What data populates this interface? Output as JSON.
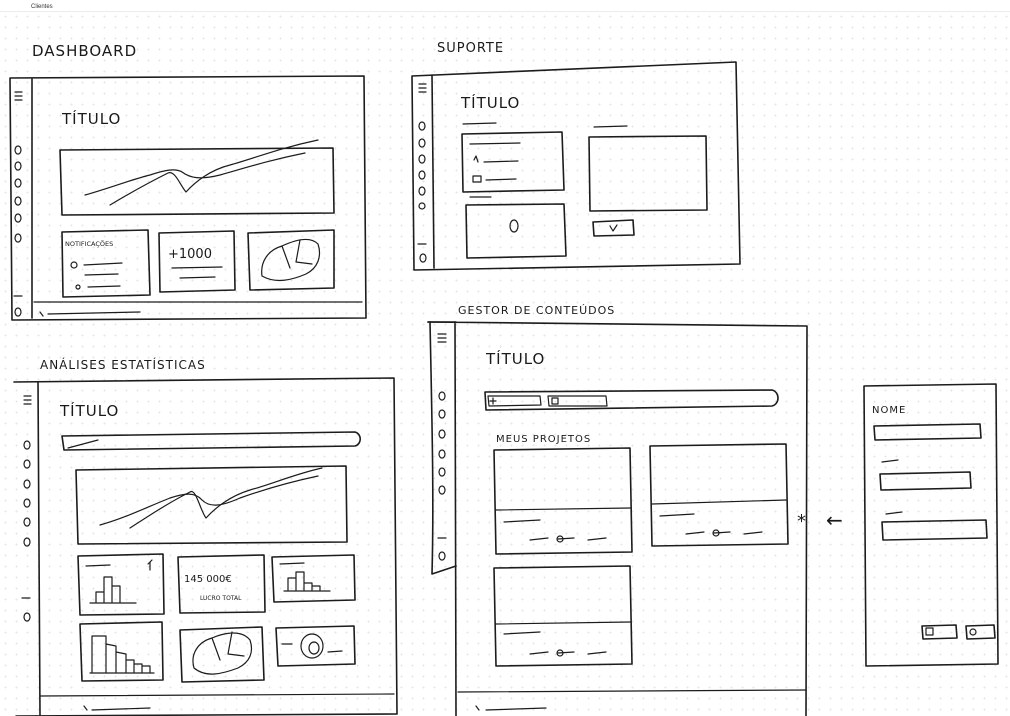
{
  "page_label": "Clientes",
  "dashboard": {
    "heading": "DASHBOARD",
    "title": "TÍTULO",
    "notifications_label": "NOTIFICAÇÕES",
    "kpi_value": "+1000"
  },
  "suporte": {
    "heading": "SUPORTE",
    "title": "TÍTULO"
  },
  "analises": {
    "heading": "ANÁLISES ESTATÍSTICAS",
    "title": "TÍTULO",
    "kpi_value": "145 000€",
    "kpi_caption": "LUCRO TOTAL"
  },
  "gestor": {
    "heading": "GESTOR DE CONTEÚDOS",
    "title": "TÍTULO",
    "projects_label": "MEUS PROJETOS"
  },
  "form": {
    "name_label": "NOME"
  },
  "annotation": {
    "asterisk": "*",
    "arrow": "←"
  }
}
